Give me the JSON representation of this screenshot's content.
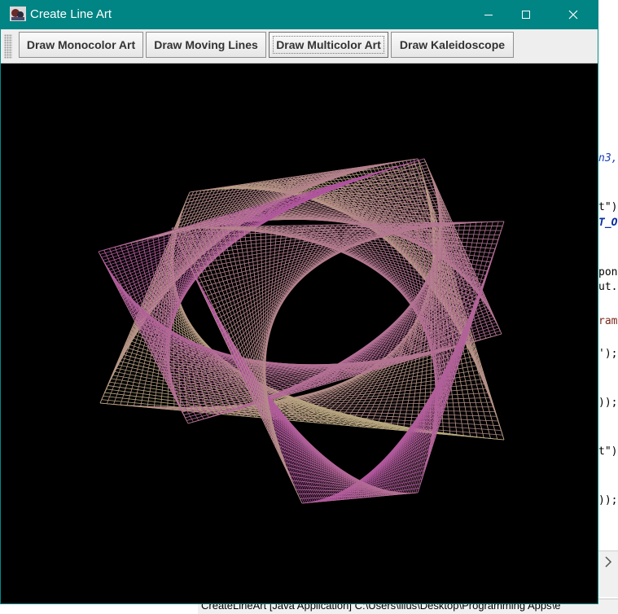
{
  "window": {
    "title": "Create Line Art",
    "icon": "java-app-icon",
    "controls": [
      "minimize-icon",
      "maximize-icon",
      "close-icon"
    ]
  },
  "toolbar": {
    "buttons": [
      {
        "label": "Draw Monocolor Art"
      },
      {
        "label": "Draw Moving Lines"
      },
      {
        "label": "Draw Multicolor Art"
      },
      {
        "label": "Draw Kaleidoscope"
      }
    ]
  },
  "art": {
    "background": "#000000",
    "color_start": "#b8ad7c",
    "color_end": "#b050a0"
  },
  "background_editor": {
    "code_fragments": [
      "n3,",
      "t\")",
      "T_O",
      "pon",
      "ut.",
      "ram",
      "');",
      "));",
      "t\")",
      "));"
    ],
    "status_text": "CreateLineArt [Java Application] C:\\Users\\lilus\\Desktop\\Programming Apps\\e"
  }
}
